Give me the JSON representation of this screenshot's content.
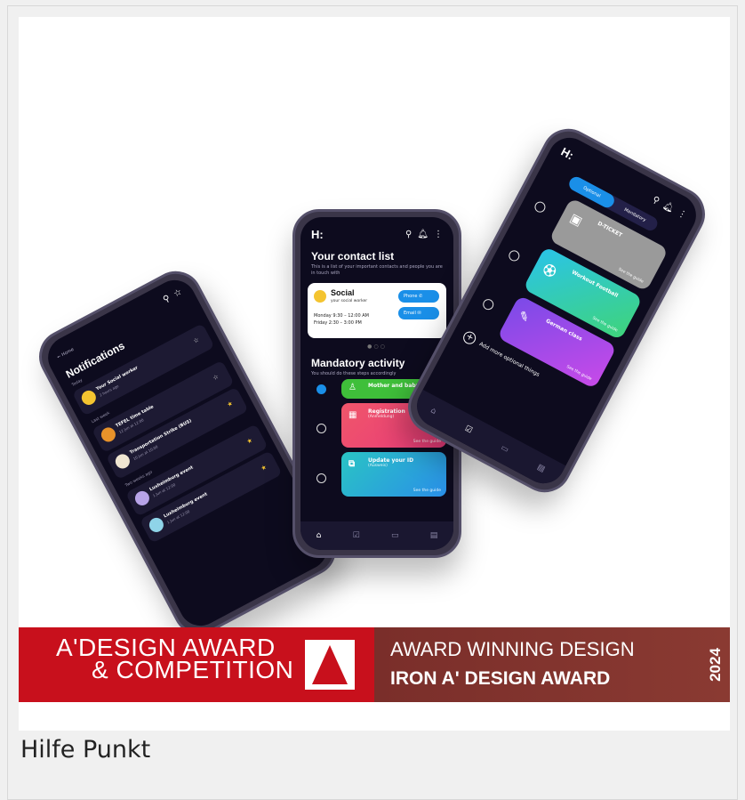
{
  "caption": "Hilfe Punkt",
  "banner": {
    "line1": "A'DESIGN AWARD",
    "line2": "& COMPETITION",
    "right1": "AWARD WINNING DESIGN",
    "right2": "IRON A' DESIGN AWARD",
    "year": "2024"
  },
  "phone_left": {
    "back": "← Home",
    "title": "Notifications",
    "sections": [
      "Today",
      "Last week",
      "Two weeks ago"
    ],
    "items": [
      {
        "title": "Your Social worker",
        "date": "2 hours ago"
      },
      {
        "title": "TEFEL time table",
        "date": "12 Jun at 12:00"
      },
      {
        "title": "Transportation Strike (BUS)",
        "date": "10 Jun at 10:00"
      },
      {
        "title": "Luxheimburg event",
        "date": "1 Jun at 12:00"
      },
      {
        "title": "Luxheimburg event",
        "date": "1 Jun at 12:00"
      }
    ]
  },
  "phone_mid": {
    "logo": "H:",
    "contacts_title": "Your contact list",
    "contacts_sub": "This is a list of your important contacts and people you are in touch with",
    "contact_name": "Social",
    "contact_role": "your social worker",
    "hours_1": "Monday  9:30 – 12:00 AM",
    "hours_2": "Friday    2:30 –  3:00 PM",
    "phone_btn": "Phone",
    "email_btn": "Email",
    "mandatory_title": "Mandatory activity",
    "mandatory_sub": "You should do these steps accordingly",
    "activities": [
      {
        "title": "Mother and baby",
        "sub": "",
        "guide": ""
      },
      {
        "title": "Registration",
        "sub": "(Anmeldung)",
        "guide": "See the guide"
      },
      {
        "title": "Update your ID",
        "sub": "(Ausweis)",
        "guide": "See the guide"
      }
    ]
  },
  "phone_right": {
    "logo": "H:",
    "tab_optional": "Optional",
    "tab_mandatory": "Mandatory",
    "options": [
      {
        "title": "D-TICKET",
        "guide": "See the guide"
      },
      {
        "title": "Workout Football",
        "guide": "See the guide"
      },
      {
        "title": "German class",
        "guide": "See the guide"
      }
    ],
    "add_more": "Add more optional things"
  },
  "colors": {
    "banner_red": "#c8101c",
    "banner_brown": "#7a2e2a",
    "accent_blue": "#1a8fe8",
    "screen_bg": "#0d0b1e"
  }
}
